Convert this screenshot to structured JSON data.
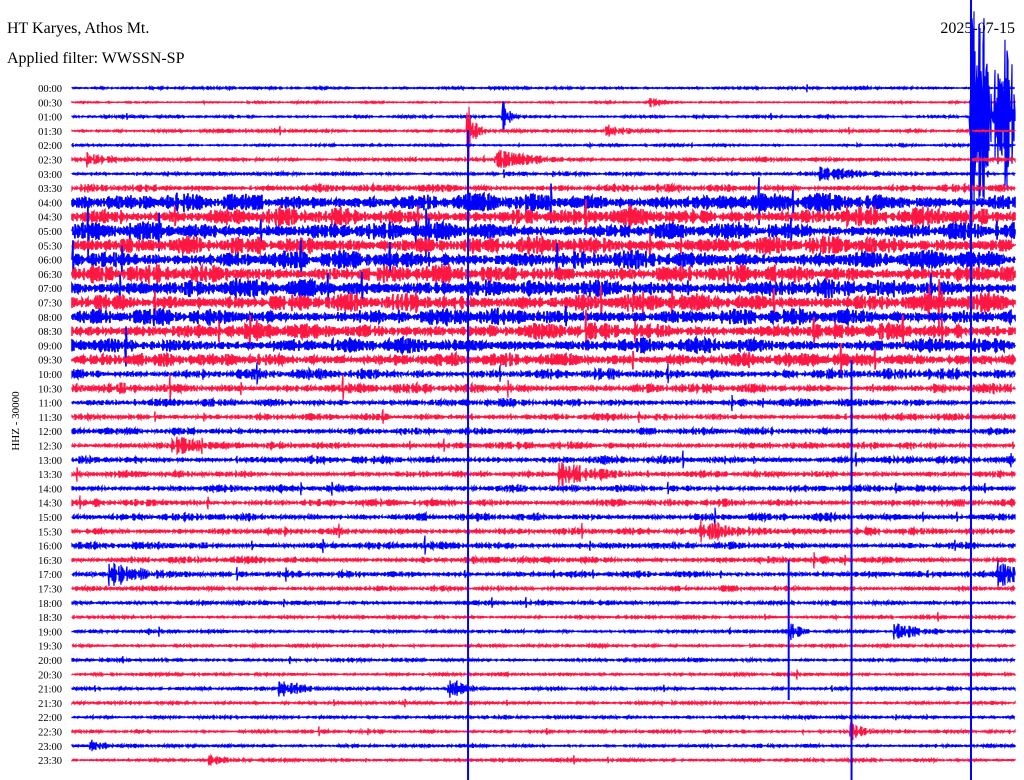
{
  "header": {
    "station": "HT Karyes, Athos Mt.",
    "filter": "Applied filter: WWSSN-SP",
    "date": "2025-07-15"
  },
  "chart_data": {
    "type": "line",
    "subtype": "helicorder",
    "ylabel": "HHZ - 30000",
    "minutes_per_row": 30,
    "colors": {
      "hour_rows": "#0000ff",
      "half_hour_rows": "#ff1744"
    },
    "row_labels": [
      "00:00",
      "00:30",
      "01:00",
      "01:30",
      "02:00",
      "02:30",
      "03:00",
      "03:30",
      "04:00",
      "04:30",
      "05:00",
      "05:30",
      "06:00",
      "06:30",
      "07:00",
      "07:30",
      "08:00",
      "08:30",
      "09:00",
      "09:30",
      "10:00",
      "10:30",
      "11:00",
      "11:30",
      "12:00",
      "12:30",
      "13:00",
      "13:30",
      "14:00",
      "14:30",
      "15:00",
      "15:30",
      "16:00",
      "16:30",
      "17:00",
      "17:30",
      "18:00",
      "18:30",
      "19:00",
      "19:30",
      "20:00",
      "20:30",
      "21:00",
      "21:30",
      "22:00",
      "22:30",
      "23:00",
      "23:30"
    ],
    "noise_level": [
      1.2,
      0.8,
      1.2,
      1.5,
      1.0,
      1.8,
      1.6,
      3.5,
      8,
      8,
      8,
      8,
      8,
      8,
      8,
      8,
      7.5,
      7,
      6.5,
      6,
      5,
      4.5,
      3.5,
      3,
      3.2,
      3.2,
      3.4,
      3,
      3.2,
      3.3,
      3.4,
      3.2,
      3.2,
      3.0,
      2.8,
      2.2,
      2.0,
      1.5,
      1.5,
      1.4,
      1.5,
      1.4,
      1.6,
      1.5,
      1.5,
      1.4,
      1.4,
      1.5
    ],
    "events": [
      {
        "row": 2,
        "minute": 28.6,
        "amplitude": 120,
        "duration": 2.5
      },
      {
        "row": 1,
        "minute": 18.4,
        "amplitude": 6,
        "duration": 0.4
      },
      {
        "row": 3,
        "minute": 17.0,
        "amplitude": 7,
        "duration": 1.0
      },
      {
        "row": 5,
        "minute": 13.5,
        "amplitude": 12,
        "duration": 1.2
      },
      {
        "row": 5,
        "minute": 0.5,
        "amplitude": 8,
        "duration": 1.0
      },
      {
        "row": 6,
        "minute": 23.8,
        "amplitude": 9,
        "duration": 1.5
      },
      {
        "row": 2,
        "minute": 13.7,
        "amplitude": 20,
        "duration": 0.2
      },
      {
        "row": 3,
        "minute": 12.6,
        "amplitude": 40,
        "duration": 0.2
      },
      {
        "row": 25,
        "minute": 3.2,
        "amplitude": 12,
        "duration": 1.2
      },
      {
        "row": 27,
        "minute": 15.5,
        "amplitude": 14,
        "duration": 1.5
      },
      {
        "row": 31,
        "minute": 20.0,
        "amplitude": 14,
        "duration": 1.5
      },
      {
        "row": 34,
        "minute": 1.2,
        "amplitude": 14,
        "duration": 1.5
      },
      {
        "row": 34,
        "minute": 29.5,
        "amplitude": 14,
        "duration": 1.0
      },
      {
        "row": 38,
        "minute": 26.2,
        "amplitude": 10,
        "duration": 1.0
      },
      {
        "row": 38,
        "minute": 22.8,
        "amplitude": 16,
        "duration": 0.3
      },
      {
        "row": 42,
        "minute": 6.6,
        "amplitude": 12,
        "duration": 0.8
      },
      {
        "row": 42,
        "minute": 12.0,
        "amplitude": 14,
        "duration": 0.5
      },
      {
        "row": 45,
        "minute": 24.8,
        "amplitude": 12,
        "duration": 0.4
      },
      {
        "row": 46,
        "minute": 0.6,
        "amplitude": 8,
        "duration": 0.5
      },
      {
        "row": 47,
        "minute": 4.4,
        "amplitude": 6,
        "duration": 0.8
      }
    ],
    "long_spikes_minutes": [
      12.6,
      28.6,
      24.8,
      22.8
    ]
  }
}
